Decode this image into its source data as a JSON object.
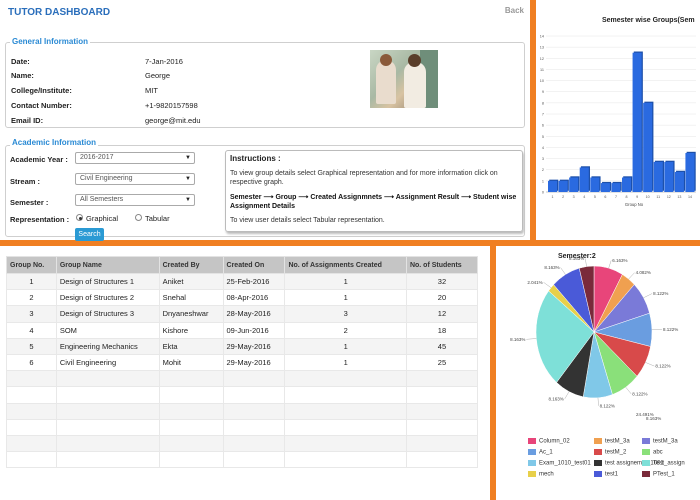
{
  "header": {
    "title": "TUTOR DASHBOARD",
    "back_label": "Back"
  },
  "general_info": {
    "legend": "General Information",
    "fields": [
      {
        "label": "Date:",
        "value": "7-Jan-2016"
      },
      {
        "label": "Name:",
        "value": "George"
      },
      {
        "label": "College/Institute:",
        "value": "MIT"
      },
      {
        "label": "Contact Number:",
        "value": "+1-9820157598"
      },
      {
        "label": "Email ID:",
        "value": "george@mit.edu"
      }
    ]
  },
  "academic_info": {
    "legend": "Academic Information",
    "academic_year": {
      "label": "Academic Year :",
      "value": "2016-2017"
    },
    "stream": {
      "label": "Stream :",
      "value": "Civil Engineering"
    },
    "semester": {
      "label": "Semester :",
      "value": "All Semesters"
    },
    "representation": {
      "label": "Representation :",
      "options": [
        "Graphical",
        "Tabular"
      ],
      "selected": "Graphical"
    },
    "search_label": "Search"
  },
  "instructions": {
    "title": "Instructions :",
    "line1": "To view group details select Graphical representation and for more information click on respective graph.",
    "flow": "Semester ⟶ Group ⟶ Created Assignmnets ⟶ Assignment Result ⟶ Student wise Assignment Details",
    "line2": "To view user details select Tabular representation."
  },
  "bar_chart": {
    "title": "Semester wise Groups(Sem",
    "xlabel": "Group No",
    "accent": "#2a6ae0"
  },
  "table": {
    "headers": [
      "Group No.",
      "Group Name",
      "Created By",
      "Created On",
      "No. of Assignments Created",
      "No. of Students"
    ],
    "rows": [
      [
        "1",
        "Design of Structures 1",
        "Aniket",
        "25-Feb-2016",
        "1",
        "32"
      ],
      [
        "2",
        "Design of Structures 2",
        "Snehal",
        "08-Apr-2016",
        "1",
        "20"
      ],
      [
        "3",
        "Design of Structures 3",
        "Dnyaneshwar",
        "28-May-2016",
        "3",
        "12"
      ],
      [
        "4",
        "SOM",
        "Kishore",
        "09-Jun-2016",
        "2",
        "18"
      ],
      [
        "5",
        "Engineering Mechanics",
        "Ekta",
        "29-May-2016",
        "1",
        "45"
      ],
      [
        "6",
        "Civil Engineering",
        "Mohit",
        "29-May-2016",
        "1",
        "25"
      ]
    ],
    "empty_rows": 6
  },
  "pie_chart": {
    "title": "Semester:2"
  },
  "chart_data": [
    {
      "type": "bar",
      "title": "Semester wise Groups(Sem",
      "xlabel": "Group No",
      "ylabel": "",
      "ylim": [
        0,
        14
      ],
      "yticks": [
        0,
        1,
        2,
        3,
        4,
        5,
        6,
        7,
        8,
        9,
        10,
        11,
        12,
        13,
        14
      ],
      "categories": [
        "1",
        "2",
        "3",
        "4",
        "5",
        "6",
        "7",
        "8",
        "9",
        "10",
        "11",
        "12",
        "13",
        "14"
      ],
      "values": [
        1,
        1,
        1.3,
        2.2,
        1.3,
        0.8,
        0.8,
        1.3,
        12.5,
        8,
        2.7,
        2.7,
        1.8,
        3.5
      ],
      "color": "#2a6ae0"
    },
    {
      "type": "pie",
      "title": "Semester:2",
      "slices": [
        {
          "label": "Column_02",
          "value": 8.122,
          "color": "#e8457a"
        },
        {
          "label": "testM_3a",
          "value": 4.082,
          "color": "#f0a050"
        },
        {
          "label": "testM_3a",
          "value": 8.163,
          "color": "#7a7ad8"
        },
        {
          "label": "Ac_1",
          "value": 8.122,
          "color": "#6a9de0"
        },
        {
          "label": "testM_2",
          "value": 8.163,
          "color": "#d84a4a"
        },
        {
          "label": "abc",
          "value": 8.122,
          "color": "#8ae07a"
        },
        {
          "label": "Exam_1010_test01",
          "value": 8.122,
          "color": "#80c8e8"
        },
        {
          "label": "test assignemnt_1001",
          "value": 8.163,
          "color": "#333333"
        },
        {
          "label": "Test_assign",
          "value": 24.491,
          "color": "#7ee0d8"
        },
        {
          "label": "mech",
          "value": 2.041,
          "color": "#e8d04a"
        },
        {
          "label": "test1",
          "value": 8.163,
          "color": "#4a5ad8"
        },
        {
          "label": "PTest_1",
          "value": 4.082,
          "color": "#7a2a3a"
        }
      ],
      "slice_labels": [
        "6.163%",
        "4.082%",
        "8.122%",
        "8.122%",
        "8.122%",
        "8.122%",
        "8.122%",
        "8.163%",
        "8.163%",
        "2.041%",
        "8.163%",
        "8.163%",
        "24.491%",
        "8.163%"
      ]
    }
  ]
}
